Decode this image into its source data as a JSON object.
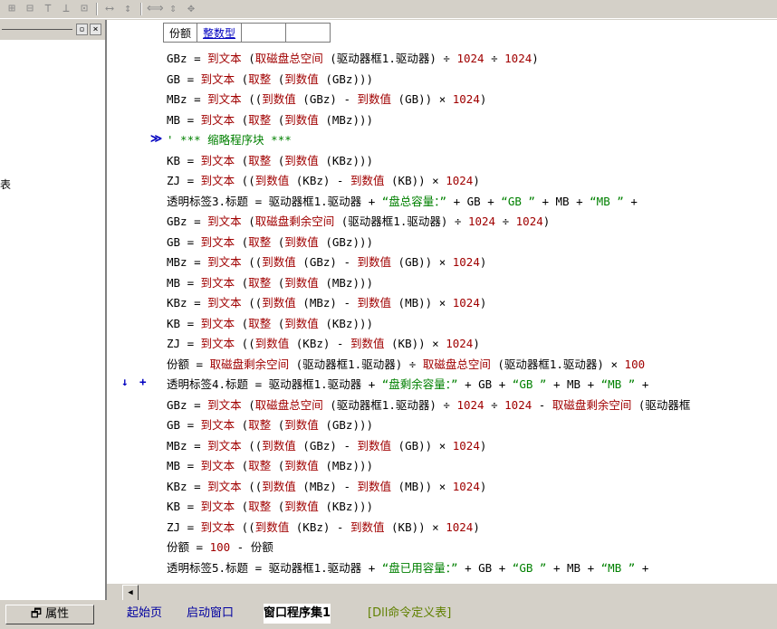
{
  "grid": {
    "col1": "份额",
    "col2": "整数型"
  },
  "code_lines": [
    {
      "html": "GBz = <span class='k'>到文本</span> (<span class='k'>取磁盘总空间</span> (驱动器框1.驱动器) ÷ <span class='n'>1024</span> ÷ <span class='n'>1024</span>)"
    },
    {
      "html": "GB = <span class='k'>到文本</span> (<span class='k'>取整</span> (<span class='k'>到数值</span> (GBz)))"
    },
    {
      "html": "MBz = <span class='k'>到文本</span> ((<span class='k'>到数值</span> (GBz) - <span class='k'>到数值</span> (GB)) × <span class='n'>1024</span>)"
    },
    {
      "html": "MB = <span class='k'>到文本</span> (<span class='k'>取整</span> (<span class='k'>到数值</span> (MBz)))"
    },
    {
      "html": "<span class='c'>' *** 缩略程序块 ***</span>"
    },
    {
      "html": "KB = <span class='k'>到文本</span> (<span class='k'>取整</span> (<span class='k'>到数值</span> (KBz)))"
    },
    {
      "html": "ZJ = <span class='k'>到文本</span> ((<span class='k'>到数值</span> (KBz) - <span class='k'>到数值</span> (KB)) × <span class='n'>1024</span>)"
    },
    {
      "html": "透明标签3.标题 = 驱动器框1.驱动器 + <span class='s'>“盘总容量：”</span> + GB + <span class='s'>“GB ”</span> + MB + <span class='s'>“MB ”</span> +"
    },
    {
      "html": "GBz = <span class='k'>到文本</span> (<span class='k'>取磁盘剩余空间</span> (驱动器框1.驱动器) ÷ <span class='n'>1024</span> ÷ <span class='n'>1024</span>)"
    },
    {
      "html": "GB = <span class='k'>到文本</span> (<span class='k'>取整</span> (<span class='k'>到数值</span> (GBz)))"
    },
    {
      "html": "MBz = <span class='k'>到文本</span> ((<span class='k'>到数值</span> (GBz) - <span class='k'>到数值</span> (GB)) × <span class='n'>1024</span>)"
    },
    {
      "html": "MB = <span class='k'>到文本</span> (<span class='k'>取整</span> (<span class='k'>到数值</span> (MBz)))"
    },
    {
      "html": "KBz = <span class='k'>到文本</span> ((<span class='k'>到数值</span> (MBz) - <span class='k'>到数值</span> (MB)) × <span class='n'>1024</span>)"
    },
    {
      "html": "KB = <span class='k'>到文本</span> (<span class='k'>取整</span> (<span class='k'>到数值</span> (KBz)))"
    },
    {
      "html": "ZJ = <span class='k'>到文本</span> ((<span class='k'>到数值</span> (KBz) - <span class='k'>到数值</span> (KB)) × <span class='n'>1024</span>)"
    },
    {
      "html": "份额 = <span class='k'>取磁盘剩余空间</span> (驱动器框1.驱动器) ÷ <span class='k'>取磁盘总空间</span> (驱动器框1.驱动器) × <span class='n'>100</span>"
    },
    {
      "html": "透明标签4.标题 = 驱动器框1.驱动器 + <span class='s'>“盘剩余容量：”</span> + GB + <span class='s'>“GB ”</span> + MB + <span class='s'>“MB ”</span> +"
    },
    {
      "html": "GBz = <span class='k'>到文本</span> (<span class='k'>取磁盘总空间</span> (驱动器框1.驱动器) ÷ <span class='n'>1024</span> ÷ <span class='n'>1024</span> - <span class='k'>取磁盘剩余空间</span> (驱动器框"
    },
    {
      "html": "GB = <span class='k'>到文本</span> (<span class='k'>取整</span> (<span class='k'>到数值</span> (GBz)))"
    },
    {
      "html": "MBz = <span class='k'>到文本</span> ((<span class='k'>到数值</span> (GBz) - <span class='k'>到数值</span> (GB)) × <span class='n'>1024</span>)"
    },
    {
      "html": "MB = <span class='k'>到文本</span> (<span class='k'>取整</span> (<span class='k'>到数值</span> (MBz)))"
    },
    {
      "html": "KBz = <span class='k'>到文本</span> ((<span class='k'>到数值</span> (MBz) - <span class='k'>到数值</span> (MB)) × <span class='n'>1024</span>)"
    },
    {
      "html": "KB = <span class='k'>到文本</span> (<span class='k'>取整</span> (<span class='k'>到数值</span> (KBz)))"
    },
    {
      "html": "ZJ = <span class='k'>到文本</span> ((<span class='k'>到数值</span> (KBz) - <span class='k'>到数值</span> (KB)) × <span class='n'>1024</span>)"
    },
    {
      "html": "份额 = <span class='n'>100</span> - 份额"
    },
    {
      "html": "透明标签5.标题 = 驱动器框1.驱动器 + <span class='s'>“盘已用容量：”</span> + GB + <span class='s'>“GB ”</span> + MB + <span class='s'>“MB ”</span> +"
    }
  ],
  "markers": {
    "collapse": "≫",
    "arrow": "↓",
    "plus": "+"
  },
  "left_panel": {
    "fragment": "表"
  },
  "bottom": {
    "property_button": "属性",
    "tabs": [
      "起始页",
      "启动窗口",
      "窗口程序集1",
      "[Dll命令定义表]"
    ]
  }
}
